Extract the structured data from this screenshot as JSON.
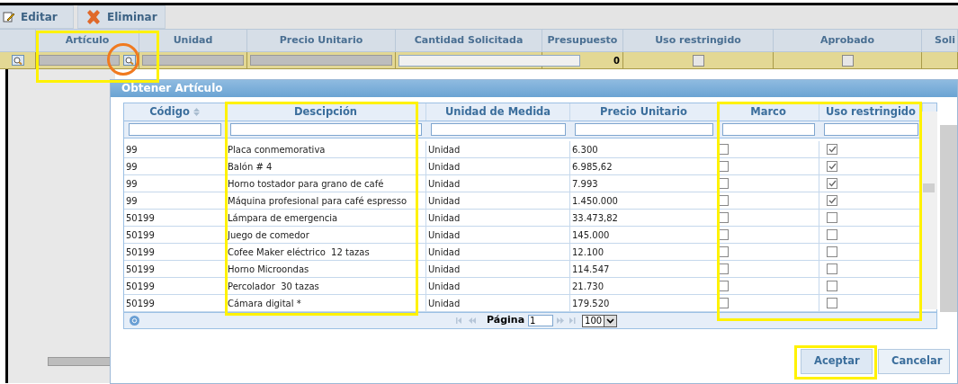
{
  "toolbar": {
    "buttons": [
      {
        "label": "Editar",
        "kind": "edit"
      },
      {
        "label": "Eliminar",
        "kind": "delete"
      }
    ]
  },
  "grid": {
    "columns": [
      "Artículo",
      "Unidad",
      "Precio Unitario",
      "Cantidad Solicitada",
      "Presupuesto",
      "Uso restringido",
      "Aprobado",
      "Soli"
    ],
    "row": {
      "presupuesto": "0",
      "uso_restringido_checked": false,
      "aprobado_checked": false
    }
  },
  "dialog": {
    "title": "Obtener Artículo",
    "columns": [
      {
        "label": "Código",
        "sortable": true
      },
      {
        "label": "Descipción",
        "sortable": false
      },
      {
        "label": "Unidad de Medida",
        "sortable": false
      },
      {
        "label": "Precio Unitario",
        "sortable": false
      },
      {
        "label": "Marco",
        "sortable": false
      },
      {
        "label": "Uso restringido",
        "sortable": false
      }
    ],
    "rows": [
      {
        "codigo": "99",
        "descripcion": "Placa conmemorativa",
        "unidad": "Unidad",
        "precio": "6.300",
        "marco": false,
        "uso_restringido": true
      },
      {
        "codigo": "99",
        "descripcion": "Balón # 4",
        "unidad": "Unidad",
        "precio": "6.985,62",
        "marco": false,
        "uso_restringido": true
      },
      {
        "codigo": "99",
        "descripcion": "Horno tostador para grano de café",
        "unidad": "Unidad",
        "precio": "7.993",
        "marco": false,
        "uso_restringido": true
      },
      {
        "codigo": "99",
        "descripcion": "Máquina profesional para café espresso",
        "unidad": "Unidad",
        "precio": "1.450.000",
        "marco": false,
        "uso_restringido": true
      },
      {
        "codigo": "50199",
        "descripcion": "Lámpara de emergencia",
        "unidad": "Unidad",
        "precio": "33.473,82",
        "marco": false,
        "uso_restringido": false
      },
      {
        "codigo": "50199",
        "descripcion": "Juego de comedor",
        "unidad": "Unidad",
        "precio": "145.000",
        "marco": false,
        "uso_restringido": false
      },
      {
        "codigo": "50199",
        "descripcion": "Cofee Maker eléctrico  12 tazas",
        "unidad": "Unidad",
        "precio": "12.100",
        "marco": false,
        "uso_restringido": false
      },
      {
        "codigo": "50199",
        "descripcion": "Horno Microondas",
        "unidad": "Unidad",
        "precio": "114.547",
        "marco": false,
        "uso_restringido": false
      },
      {
        "codigo": "50199",
        "descripcion": "Percolador  30 tazas",
        "unidad": "Unidad",
        "precio": "21.730",
        "marco": false,
        "uso_restringido": false
      },
      {
        "codigo": "50199",
        "descripcion": "Cámara digital *",
        "unidad": "Unidad",
        "precio": "179.520",
        "marco": false,
        "uso_restringido": false
      }
    ],
    "pager": {
      "label": "Página",
      "page": "1",
      "page_size": "100"
    },
    "buttons": [
      {
        "label": "Aceptar",
        "primary": true
      },
      {
        "label": "Cancelar",
        "primary": false
      }
    ]
  }
}
